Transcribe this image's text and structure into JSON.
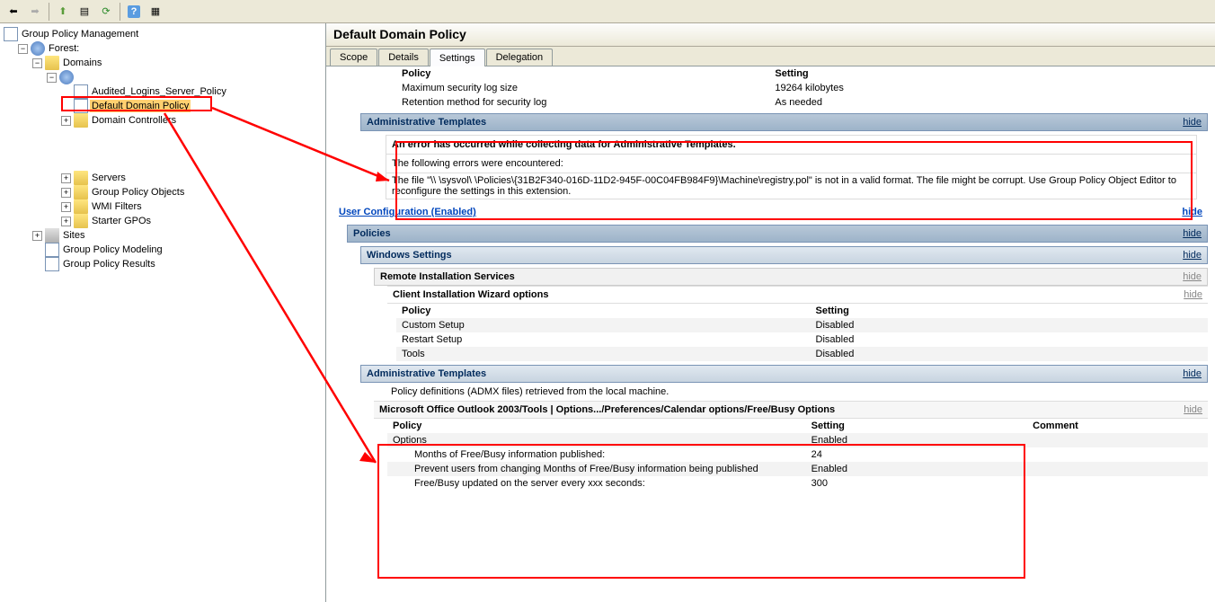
{
  "tree": {
    "root": "Group Policy Management",
    "forest": "Forest:",
    "domains": "Domains",
    "domainBlank": "",
    "audited": "Audited_Logins_Server_Policy",
    "defaultDomain": "Default Domain Policy",
    "domainControllers": "Domain Controllers",
    "servers": "Servers",
    "gpo": "Group Policy Objects",
    "wmi": "WMI Filters",
    "starter": "Starter GPOs",
    "sites": "Sites",
    "modeling": "Group Policy Modeling",
    "results": "Group Policy Results"
  },
  "title": "Default Domain Policy",
  "tabs": {
    "scope": "Scope",
    "details": "Details",
    "settings": "Settings",
    "delegation": "Delegation"
  },
  "hide": "hide",
  "topTable": {
    "hPolicy": "Policy",
    "hSetting": "Setting",
    "r1p": "Maximum security log size",
    "r1s": "19264 kilobytes",
    "r2p": "Retention method for security log",
    "r2s": "As needed"
  },
  "adminTemplates": "Administrative Templates",
  "error": {
    "title": "An error has occurred while collecting data for Administrative Templates.",
    "sub": "The following errors were encountered:",
    "msg": "The file \"\\\\                                           \\sysvol\\                        \\Policies\\{31B2F340-016D-11D2-945F-00C04FB984F9}\\Machine\\registry.pol\" is not in a valid format. The file might be corrupt. Use Group Policy Object Editor to reconfigure the settings in this extension."
  },
  "userConf": "User Configuration (Enabled)",
  "policies": "Policies",
  "winSettings": "Windows Settings",
  "ris": "Remote Installation Services",
  "ciw": "Client Installation Wizard options",
  "ciwTable": {
    "hPolicy": "Policy",
    "hSetting": "Setting",
    "r1p": "Custom Setup",
    "r1s": "Disabled",
    "r2p": "Restart Setup",
    "r2s": "Disabled",
    "r3p": "Tools",
    "r3s": "Disabled"
  },
  "adminTemplates2": "Administrative Templates",
  "admxNote": "Policy definitions (ADMX files) retrieved from the local machine.",
  "outlookHdr": "Microsoft Office Outlook 2003/Tools | Options.../Preferences/Calendar options/Free/Busy Options",
  "outlookTable": {
    "hPolicy": "Policy",
    "hSetting": "Setting",
    "hComment": "Comment",
    "r1p": "Options",
    "r1s": "Enabled",
    "s1p": "Months of Free/Busy information published:",
    "s1s": "24",
    "s2p": "Prevent users from changing Months of Free/Busy information being published",
    "s2s": "Enabled",
    "s3p": "Free/Busy updated on the server every xxx seconds:",
    "s3s": "300"
  }
}
